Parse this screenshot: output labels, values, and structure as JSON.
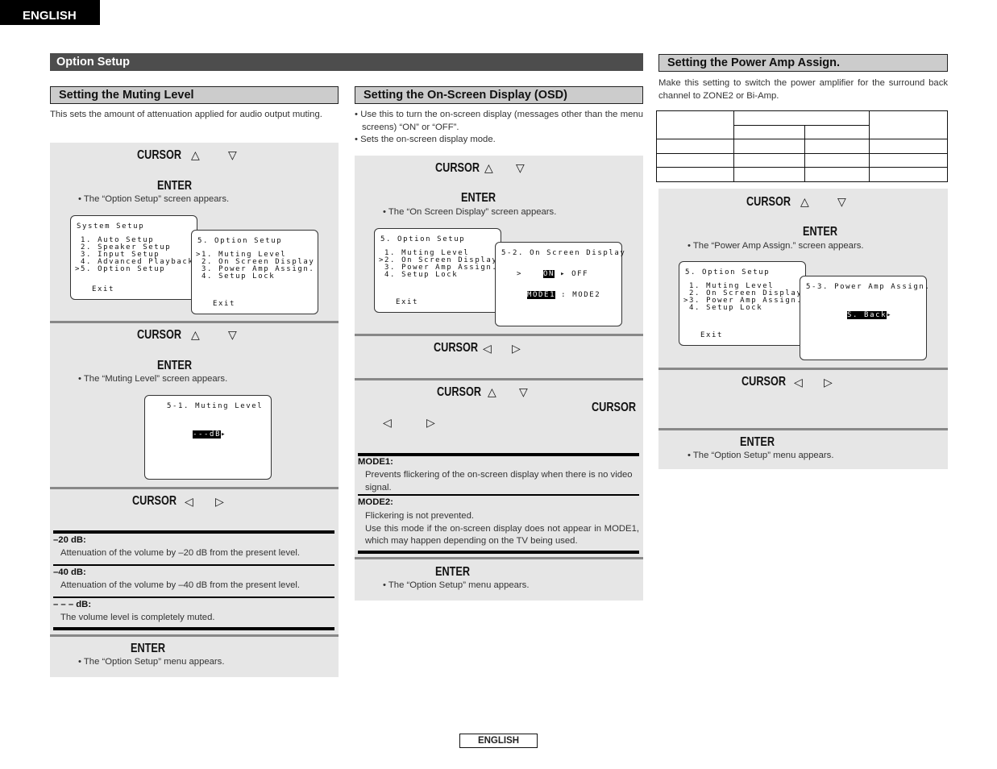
{
  "header": {
    "language_tab": "ENGLISH",
    "section_title": "Option Setup"
  },
  "footer": {
    "language_label": "ENGLISH"
  },
  "icons": {
    "up": "△",
    "down": "▽",
    "left": "◁",
    "right": "▷",
    "play": "▸"
  },
  "muting": {
    "title": "Setting the Muting Level",
    "intro": "This sets the amount of attenuation applied for audio output muting.",
    "step1": {
      "cursor_label": "CURSOR",
      "enter_label": "ENTER",
      "note": "• The “Option Setup” screen appears.",
      "screen_system": {
        "title": "System Setup",
        "items": [
          " 1. Auto Setup",
          " 2. Speaker Setup",
          " 3. Input Setup",
          " 4. Advanced Playback",
          ">5. Option Setup"
        ],
        "exit": "Exit"
      },
      "screen_option": {
        "title": "5. Option Setup",
        "items": [
          ">1. Muting Level",
          " 2. On Screen Display",
          " 3. Power Amp Assign.",
          " 4. Setup Lock"
        ],
        "exit": "Exit"
      }
    },
    "step2": {
      "cursor_label": "CURSOR",
      "enter_label": "ENTER",
      "note": "• The “Muting Level” screen appears.",
      "screen": {
        "title": "5-1. Muting Level",
        "value": "---dB"
      }
    },
    "step3": {
      "cursor_label": "CURSOR"
    },
    "options": [
      {
        "term": "–20 dB:",
        "desc": "Attenuation of the volume by –20 dB from the present level."
      },
      {
        "term": "–40 dB:",
        "desc": "Attenuation of the volume by –40 dB from the present level."
      },
      {
        "term": "– – – dB:",
        "desc": "The volume level is completely muted."
      }
    ],
    "step4": {
      "enter_label": "ENTER",
      "note": "• The “Option Setup” menu appears."
    }
  },
  "osd": {
    "title": "Setting the On-Screen Display (OSD)",
    "bullets": [
      "• Use this to turn the on-screen display (messages other than the menu screens) “ON” or “OFF”.",
      "• Sets the on-screen display mode."
    ],
    "step1": {
      "cursor_label": "CURSOR",
      "enter_label": "ENTER",
      "note": "• The “On Screen Display” screen appears.",
      "screen_option": {
        "title": "5. Option Setup",
        "items": [
          " 1. Muting Level",
          ">2. On Screen Display",
          " 3. Power Amp Assign.",
          " 4. Setup Lock"
        ],
        "exit": "Exit"
      },
      "screen_osd": {
        "title": "5-2. On Screen Display",
        "pointer": ">",
        "on": "ON",
        "off": "OFF",
        "mode1": "MODE1",
        "sep": ":",
        "mode2": "MODE2"
      }
    },
    "step2": {
      "cursor_label": "CURSOR"
    },
    "step3": {
      "cursor_label": "CURSOR",
      "cursor_label_2": "CURSOR"
    },
    "modes": [
      {
        "term": "MODE1:",
        "desc": [
          "Prevents flickering of the on-screen display when there is no video signal."
        ]
      },
      {
        "term": "MODE2:",
        "desc": [
          "Flickering is not prevented.",
          "Use this mode if the on-screen display does not appear in MODE1, which may happen depending on the TV being used."
        ]
      }
    ],
    "step4": {
      "enter_label": "ENTER",
      "note": "• The “Option Setup” menu appears."
    }
  },
  "amp": {
    "title": "Setting the Power Amp Assign.",
    "intro": "Make this setting to switch the power amplifier for the surround back channel to ZONE2 or Bi-Amp.",
    "table": {
      "rows": 3,
      "cols": 4
    },
    "step1": {
      "cursor_label": "CURSOR",
      "enter_label": "ENTER",
      "note": "• The “Power Amp Assign.” screen appears.",
      "screen_option": {
        "title": "5. Option Setup",
        "items": [
          " 1. Muting Level",
          " 2. On Screen Display",
          ">3. Power Amp Assign.",
          " 4. Setup Lock"
        ],
        "exit": "Exit"
      },
      "screen_amp": {
        "title": "5-3. Power Amp Assign.",
        "value": "S. Back"
      }
    },
    "step2": {
      "cursor_label": "CURSOR"
    },
    "step3": {
      "enter_label": "ENTER",
      "note": "• The “Option Setup” menu appears."
    }
  }
}
